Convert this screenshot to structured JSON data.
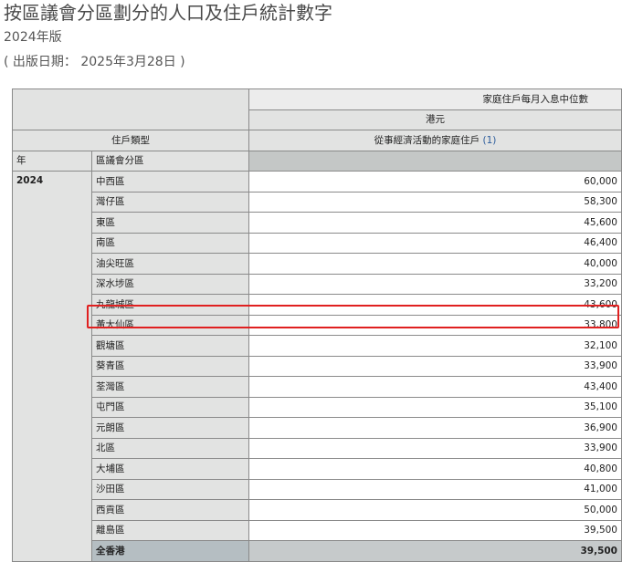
{
  "header": {
    "title": "按區議會分區劃分的人口及住戶統計數字",
    "edition": "2024年版",
    "release": "( 出版日期： 2025年3月28日 )"
  },
  "table": {
    "col_header_main": "家庭住戶每月入息中位數",
    "col_header_unit": "港元",
    "row_header_type": "住戶類型",
    "col_header_sub": "從事經濟活動的家庭住戶",
    "col_header_sub_note": "(1)",
    "year_label": "年",
    "district_label": "區議會分區",
    "year": "2024",
    "rows": [
      {
        "district": "中西區",
        "value": "60,000"
      },
      {
        "district": "灣仔區",
        "value": "58,300"
      },
      {
        "district": "東區",
        "value": "45,600"
      },
      {
        "district": "南區",
        "value": "46,400"
      },
      {
        "district": "油尖旺區",
        "value": "40,000"
      },
      {
        "district": "深水埗區",
        "value": "33,200"
      },
      {
        "district": "九龍城區",
        "value": "43,600"
      },
      {
        "district": "黃大仙區",
        "value": "33,800"
      },
      {
        "district": "觀塘區",
        "value": "32,100"
      },
      {
        "district": "葵青區",
        "value": "33,900"
      },
      {
        "district": "荃灣區",
        "value": "43,400"
      },
      {
        "district": "屯門區",
        "value": "35,100"
      },
      {
        "district": "元朗區",
        "value": "36,900"
      },
      {
        "district": "北區",
        "value": "33,900"
      },
      {
        "district": "大埔區",
        "value": "40,800"
      },
      {
        "district": "沙田區",
        "value": "41,000"
      },
      {
        "district": "西貢區",
        "value": "50,000"
      },
      {
        "district": "離島區",
        "value": "39,500"
      }
    ],
    "total": {
      "district": "全香港",
      "value": "39,500"
    }
  },
  "colors": {
    "highlight": "#e02020",
    "header_bg": "#e2e3e2",
    "total_bg": "#b5bec2"
  }
}
